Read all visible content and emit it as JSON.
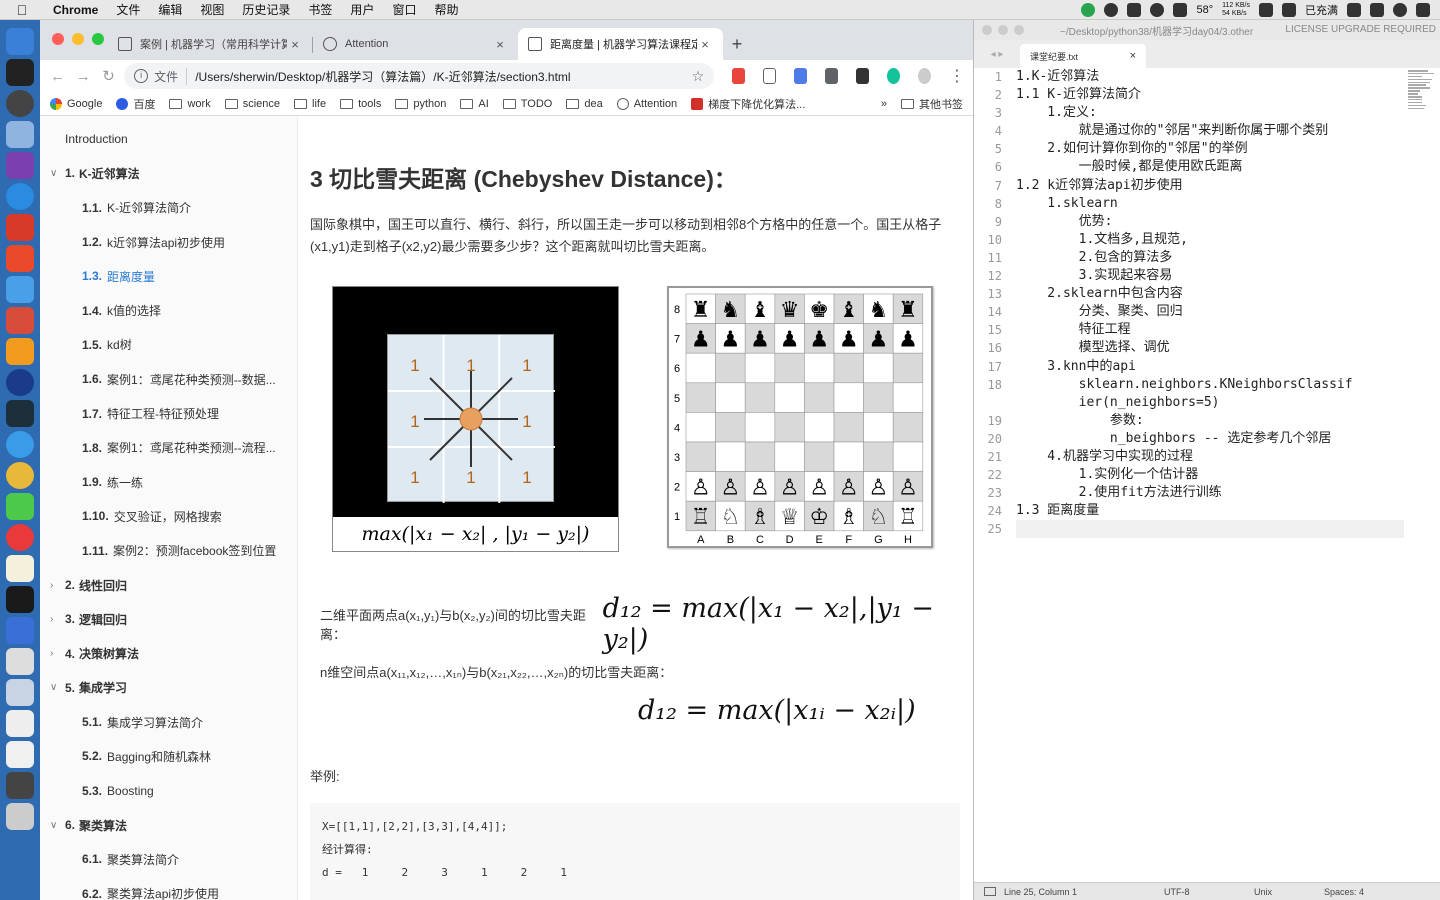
{
  "menubar": {
    "app": "Chrome",
    "menus": [
      "文件",
      "编辑",
      "视图",
      "历史记录",
      "书签",
      "用户",
      "窗口",
      "帮助"
    ],
    "temp": "58°",
    "net_up": "112 KB/s",
    "net_down": "54 KB/s",
    "battery": "已充满"
  },
  "tabs": [
    {
      "title": "案例 | 机器学习（常用科学计算",
      "close": "×"
    },
    {
      "title": "Attention",
      "close": "×"
    },
    {
      "title": "距离度量 | 机器学习算法课程定",
      "close": "×"
    }
  ],
  "toolbar": {
    "scheme": "文件",
    "url": "/Users/sherwin/Desktop/机器学习（算法篇）/K-近邻算法/section3.html"
  },
  "bookmarks": [
    "Google",
    "百度",
    "work",
    "science",
    "life",
    "tools",
    "python",
    "AI",
    "TODO",
    "dea",
    "Attention",
    "梯度下降优化算法..."
  ],
  "bookmarks_more": "»",
  "bookmarks_other": "其他书签",
  "toc": [
    {
      "level": 0,
      "num": "",
      "label": "Introduction"
    },
    {
      "level": 1,
      "num": "1.",
      "label": "K-近邻算法",
      "caret": "∨"
    },
    {
      "level": 2,
      "num": "1.1.",
      "label": "K-近邻算法简介"
    },
    {
      "level": 2,
      "num": "1.2.",
      "label": "k近邻算法api初步使用"
    },
    {
      "level": 2,
      "num": "1.3.",
      "label": "距离度量",
      "active": true
    },
    {
      "level": 2,
      "num": "1.4.",
      "label": "k值的选择"
    },
    {
      "level": 2,
      "num": "1.5.",
      "label": "kd树"
    },
    {
      "level": 2,
      "num": "1.6.",
      "label": "案例1：鸢尾花种类预测--数据..."
    },
    {
      "level": 2,
      "num": "1.7.",
      "label": "特征工程-特征预处理"
    },
    {
      "level": 2,
      "num": "1.8.",
      "label": "案例1：鸢尾花种类预测--流程..."
    },
    {
      "level": 2,
      "num": "1.9.",
      "label": "练一练"
    },
    {
      "level": 2,
      "num": "1.10.",
      "label": "交叉验证，网格搜索"
    },
    {
      "level": 2,
      "num": "1.11.",
      "label": "案例2：预测facebook签到位置"
    },
    {
      "level": 1,
      "num": "2.",
      "label": "线性回归",
      "caret": "›"
    },
    {
      "level": 1,
      "num": "3.",
      "label": "逻辑回归",
      "caret": "›"
    },
    {
      "level": 1,
      "num": "4.",
      "label": "决策树算法",
      "caret": "›"
    },
    {
      "level": 1,
      "num": "5.",
      "label": "集成学习",
      "caret": "∨"
    },
    {
      "level": 2,
      "num": "5.1.",
      "label": "集成学习算法简介"
    },
    {
      "level": 2,
      "num": "5.2.",
      "label": "Bagging和随机森林"
    },
    {
      "level": 2,
      "num": "5.3.",
      "label": "Boosting"
    },
    {
      "level": 1,
      "num": "6.",
      "label": "聚类算法",
      "caret": "∨"
    },
    {
      "level": 2,
      "num": "6.1.",
      "label": "聚类算法简介"
    },
    {
      "level": 2,
      "num": "6.2.",
      "label": "聚类算法api初步使用"
    }
  ],
  "content": {
    "heading": "3 切比雪夫距离 (Chebyshev Distance)：",
    "paragraph": "国际象棋中，国王可以直行、横行、斜行，所以国王走一步可以移动到相邻8个方格中的任意一个。国王从格子(x1,y1)走到格子(x2,y2)最少需要多少步？这个距离就叫切比雪夫距离。",
    "king_formula": "max(|x₁ − x₂| , |y₁ − y₂|)",
    "grid_number": "1",
    "chess_ranks": [
      "8",
      "7",
      "6",
      "5",
      "4",
      "3",
      "2",
      "1"
    ],
    "chess_files": [
      "A",
      "B",
      "C",
      "D",
      "E",
      "F",
      "G",
      "H"
    ],
    "back_rank": [
      "♜",
      "♞",
      "♝",
      "♛",
      "♚",
      "♝",
      "♞",
      "♜"
    ],
    "white_back_rank": [
      "♖",
      "♘",
      "♗",
      "♕",
      "♔",
      "♗",
      "♘",
      "♖"
    ],
    "black_pawn": "♟",
    "white_pawn": "♙",
    "formula2_text": "二维平面两点a(x₁,y₁)与b(x₂,y₂)间的切比雪夫距离：",
    "formula2": "d₁₂ = max(|x₁ − x₂|,|y₁ − y₂|)",
    "formula3_text": "n维空间点a(x₁₁,x₁₂,…,x₁ₙ)与b(x₂₁,x₂₂,…,x₂ₙ)的切比雪夫距离：",
    "formula3": "d₁₂ = max(|x₁ᵢ − x₂ᵢ|)",
    "example_label": "举例:",
    "code": "X=[[1,1],[2,2],[3,3],[4,4]];\n经计算得:\nd =   1     2     3     1     2     1"
  },
  "editor": {
    "path": "~/Desktop/python38/机器学习day04/3.other",
    "license": "LICENSE UPGRADE REQUIRED",
    "tab": "课堂纪要.txt",
    "tab_close": "×",
    "arrows": "◂ ▸",
    "lines": [
      {
        "n": "1",
        "t": "1.K-近邻算法"
      },
      {
        "n": "2",
        "t": "1.1 K-近邻算法简介"
      },
      {
        "n": "3",
        "t": "    1.定义:"
      },
      {
        "n": "4",
        "t": "        就是通过你的\"邻居\"来判断你属于哪个类别"
      },
      {
        "n": "5",
        "t": "    2.如何计算你到你的\"邻居\"的举例"
      },
      {
        "n": "6",
        "t": "        一般时候,都是使用欧氏距离"
      },
      {
        "n": "7",
        "t": "1.2 k近邻算法api初步使用"
      },
      {
        "n": "8",
        "t": "    1.sklearn"
      },
      {
        "n": "9",
        "t": "        优势:"
      },
      {
        "n": "10",
        "t": "        1.文档多,且规范,"
      },
      {
        "n": "11",
        "t": "        2.包含的算法多"
      },
      {
        "n": "12",
        "t": "        3.实现起来容易"
      },
      {
        "n": "13",
        "t": "    2.sklearn中包含内容"
      },
      {
        "n": "14",
        "t": "        分类、聚类、回归"
      },
      {
        "n": "15",
        "t": "        特征工程"
      },
      {
        "n": "16",
        "t": "        模型选择、调优"
      },
      {
        "n": "17",
        "t": "    3.knn中的api"
      },
      {
        "n": "18",
        "t": "        sklearn.neighbors.KNeighborsClassif"
      },
      {
        "n": "",
        "t": "        ier(n_neighbors=5)"
      },
      {
        "n": "19",
        "t": "            参数:"
      },
      {
        "n": "20",
        "t": "            n_beighbors -- 选定参考几个邻居"
      },
      {
        "n": "21",
        "t": "    4.机器学习中实现的过程"
      },
      {
        "n": "22",
        "t": "        1.实例化一个估计器"
      },
      {
        "n": "23",
        "t": "        2.使用fit方法进行训练"
      },
      {
        "n": "24",
        "t": "1.3 距离度量"
      },
      {
        "n": "25",
        "t": ""
      }
    ],
    "status": {
      "position": "Line 25, Column 1",
      "encoding": "UTF-8",
      "line_endings": "Unix",
      "indent": "Spaces: 4"
    }
  },
  "colors": {
    "accent": "#2b7bd4",
    "dock": "#2e6bb0"
  }
}
